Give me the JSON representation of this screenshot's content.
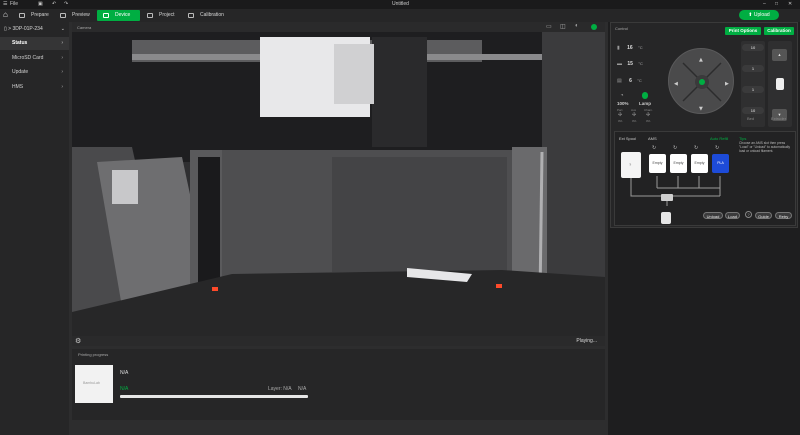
{
  "titlebar": {
    "menu_label": "File",
    "window_title": "Untitled"
  },
  "tabs": [
    {
      "label": "Prepare"
    },
    {
      "label": "Preview"
    },
    {
      "label": "Device"
    },
    {
      "label": "Project"
    },
    {
      "label": "Calibration"
    }
  ],
  "upload_label": "Upload",
  "sidebar": {
    "device_name": "3DP-01P-234",
    "items": [
      {
        "label": "Status"
      },
      {
        "label": "MicroSD Card"
      },
      {
        "label": "Update"
      },
      {
        "label": "HMS"
      }
    ]
  },
  "camera": {
    "header_label": "Camera",
    "status_label": "Playing..."
  },
  "printing_progress": {
    "title": "Printing progress",
    "thumbnail_label": "BambuLab",
    "file_name": "N/A",
    "status_value": "N/A",
    "layer_label": "Layer: N/A",
    "layer_value": "N/A",
    "progress": 0.0
  },
  "control": {
    "title": "Control",
    "print_options_label": "Print Options",
    "calibration_label": "Calibration",
    "temps": [
      {
        "value": "16",
        "unit": "°C"
      },
      {
        "value": "15",
        "unit": "°C"
      },
      {
        "value": "6",
        "unit": "°C"
      }
    ],
    "speed_value": "100%",
    "lamp_label": "Lamp",
    "fan_labels": [
      "Part",
      "Aux",
      "Cham."
    ],
    "fan_values": [
      "0%",
      "0%",
      "0%"
    ],
    "z_steps": [
      "10",
      "1",
      "1",
      "10"
    ],
    "bed_label": "Bed",
    "extruder_label": "Extruder",
    "ext_spool_label": "Ext Spool",
    "ams_label": "AMS",
    "auto_refill_label": "Auto Refill",
    "tips_title": "Tips",
    "tips_text": "Choose an AMS slot then press \"Load\" or \"Unload\" to automatically load or unload filament.",
    "slots": [
      {
        "label": "Empty"
      },
      {
        "label": "Empty"
      },
      {
        "label": "Empty"
      },
      {
        "label": "PLA"
      }
    ],
    "slot_colors": [
      "#ffffff",
      "#ffffff",
      "#ffffff",
      "#1d4bd8"
    ],
    "ext_slot_label": "?",
    "unload_label": "Unload",
    "load_label": "Load",
    "guide_label": "Guide",
    "retry_label": "Retry"
  }
}
